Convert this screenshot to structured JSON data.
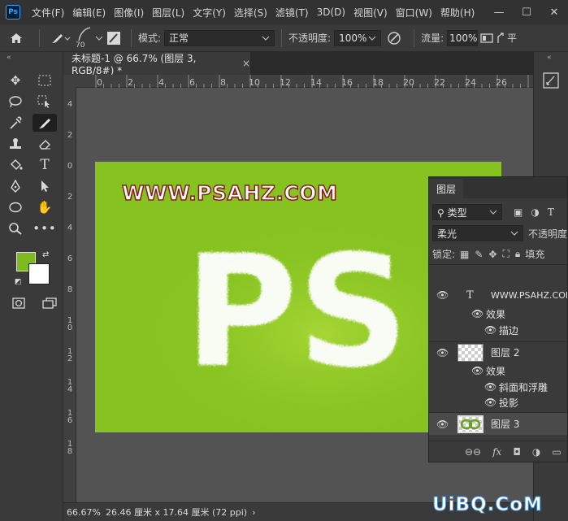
{
  "app": {
    "logo_text": "Ps",
    "menu": [
      "文件(F)",
      "编辑(E)",
      "图像(I)",
      "图层(L)",
      "文字(Y)",
      "选择(S)",
      "滤镜(T)",
      "3D(D)",
      "视图(V)",
      "窗口(W)",
      "帮助(H)"
    ],
    "window_controls": [
      "—",
      "☐",
      "✕"
    ]
  },
  "options": {
    "brush_size": "70",
    "mode_label": "模式:",
    "mode_value": "正常",
    "opacity_label": "不透明度:",
    "opacity_value": "100%",
    "flow_label": "流量:",
    "flow_value": "100%",
    "smoothing_label": "平"
  },
  "toolbar": {
    "collapse": "«",
    "fg_color": "#7fbb1f",
    "bg_color": "#ffffff"
  },
  "document": {
    "tab_title": "未标题-1 @ 66.7% (图层 3, RGB/8#) *",
    "tab_close": "×"
  },
  "ruler": {
    "top": [
      "0",
      "2",
      "4",
      "6",
      "8",
      "10",
      "12",
      "14",
      "16",
      "18",
      "20",
      "22",
      "24",
      "26"
    ],
    "left": [
      "4",
      "2",
      "0",
      "2",
      "4",
      "6",
      "8",
      "10",
      "12",
      "14",
      "16",
      "18"
    ]
  },
  "canvas": {
    "background": "#86c220",
    "watermark": "WWW.PSAHZ.COM",
    "art_letters": "PS"
  },
  "layers_panel": {
    "tab": "图层",
    "filter_label": "类型",
    "blend_mode": "柔光",
    "opacity_label": "不透明度",
    "lock_label": "锁定:",
    "fill_label": "填充",
    "layers": [
      {
        "name": "WWW.PSAHZ.COM",
        "type": "text",
        "effects_label": "效果",
        "effects": [
          "描边"
        ]
      },
      {
        "name": "图层 2",
        "type": "pixel",
        "effects_label": "效果",
        "effects": [
          "斜面和浮雕",
          "投影"
        ]
      },
      {
        "name": "图层 3",
        "type": "pixel",
        "selected": true
      }
    ],
    "footer": [
      "⊖⊖",
      "fx",
      "◘",
      "◑",
      "▭"
    ]
  },
  "status": {
    "zoom": "66.67%",
    "doc_size": "26.46 厘米 x 17.64 厘米 (72 ppi)",
    "arrow": "›"
  },
  "site_logo": "UiBQ.CoM"
}
